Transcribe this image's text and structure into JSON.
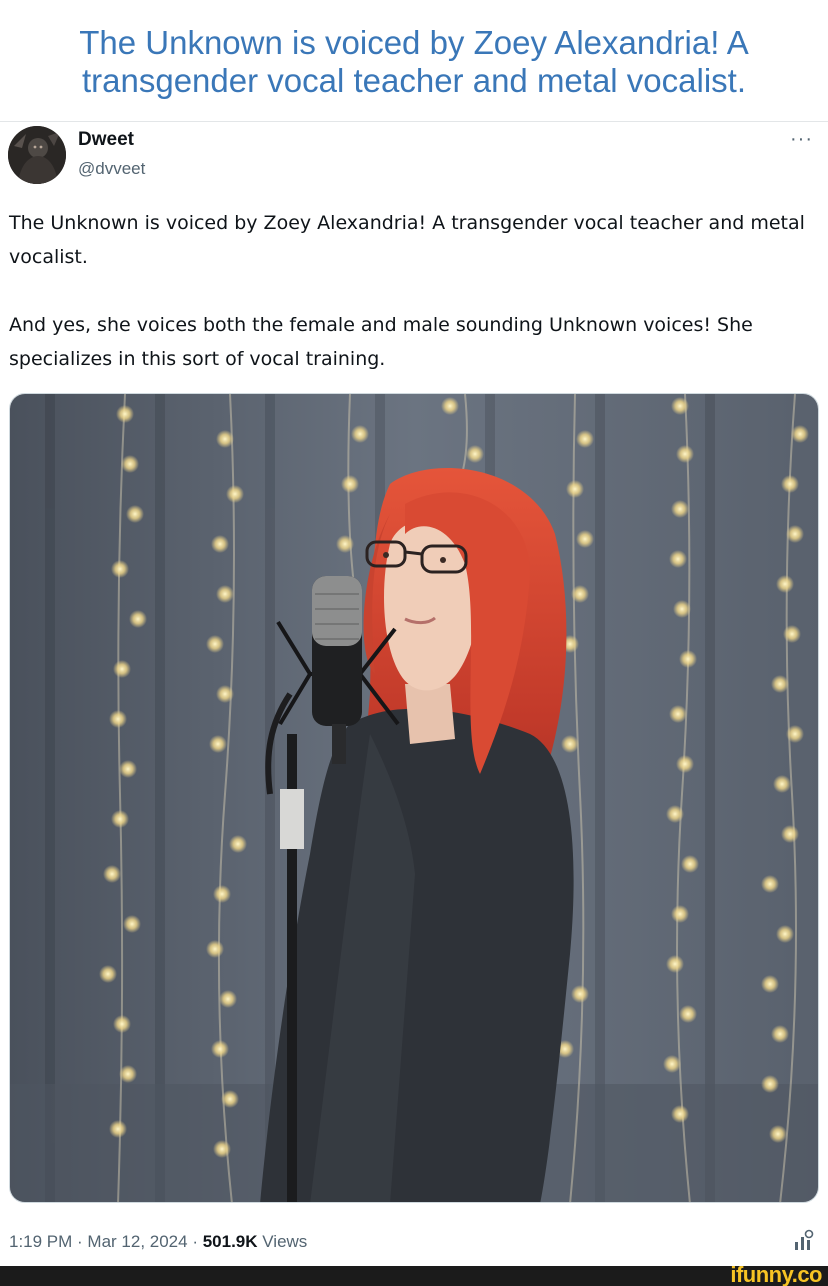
{
  "headline": "The Unknown is voiced by Zoey Alexandria! A transgender vocal teacher and metal vocalist.",
  "tweet": {
    "display_name": "Dweet",
    "handle": "@dvveet",
    "more_icon": "more-horizontal-icon",
    "text": "The Unknown is voiced by Zoey Alexandria! A transgender vocal teacher and metal vocalist.\n\nAnd yes, she voices both the female and male sounding Unknown voices! She specializes in this sort of vocal training.",
    "time": "1:19 PM · Mar 12, 2024 · ",
    "views_count": "501.9K",
    "views_label": " Views",
    "analytics_icon": "analytics-icon"
  },
  "watermark": "ifunny.co",
  "colors": {
    "headline": "#3a77b8",
    "text": "#0f1419",
    "secondary": "#536471",
    "watermark": "#f6c324"
  }
}
